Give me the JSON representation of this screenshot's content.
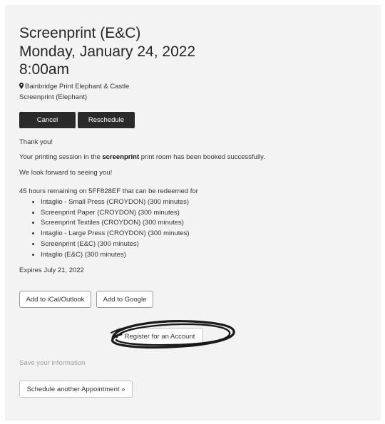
{
  "appointment": {
    "title": "Screenprint (E&C)",
    "date": "Monday, January 24, 2022",
    "time": "8:00am",
    "location": "Bainbridge Print Elephant & Castle",
    "calendar": "Screenprint (Elephant)"
  },
  "actions": {
    "cancel_label": "Cancel",
    "reschedule_label": "Reschedule"
  },
  "confirmation": {
    "thanks": "Thank you!",
    "booked_prefix": "Your printing session in the ",
    "booked_room": "screenprint",
    "booked_suffix": " print room has been booked successfully.",
    "look_forward": "We look forward to seeing you!"
  },
  "package": {
    "remaining_text": "45 hours remaining on 5FF828EF that can be redeemed for",
    "items": [
      "Intaglio - Small Press (CROYDON) (300 minutes)",
      "Screenprint Paper (CROYDON) (300 minutes)",
      "Screenprint Textiles (CROYDON) (300 minutes)",
      "Intaglio - Large Press (CROYDON) (300 minutes)",
      "Screenprint (E&C) (300 minutes)",
      "Intaglio (E&C) (300 minutes)"
    ],
    "expires": "Expires July 21, 2022"
  },
  "calendar_buttons": {
    "ical_label": "Add to iCal/Outlook",
    "google_label": "Add to Google"
  },
  "account": {
    "register_label": "Register for an Account",
    "save_info": "Save your information"
  },
  "schedule_another_label": "Schedule another Appointment »",
  "icons": {
    "location": "map-pin-icon"
  },
  "colors": {
    "dark_button": "#2a2a2a",
    "panel_background": "#f3f3f3",
    "annotation_scribble": "#1a1a1a"
  }
}
